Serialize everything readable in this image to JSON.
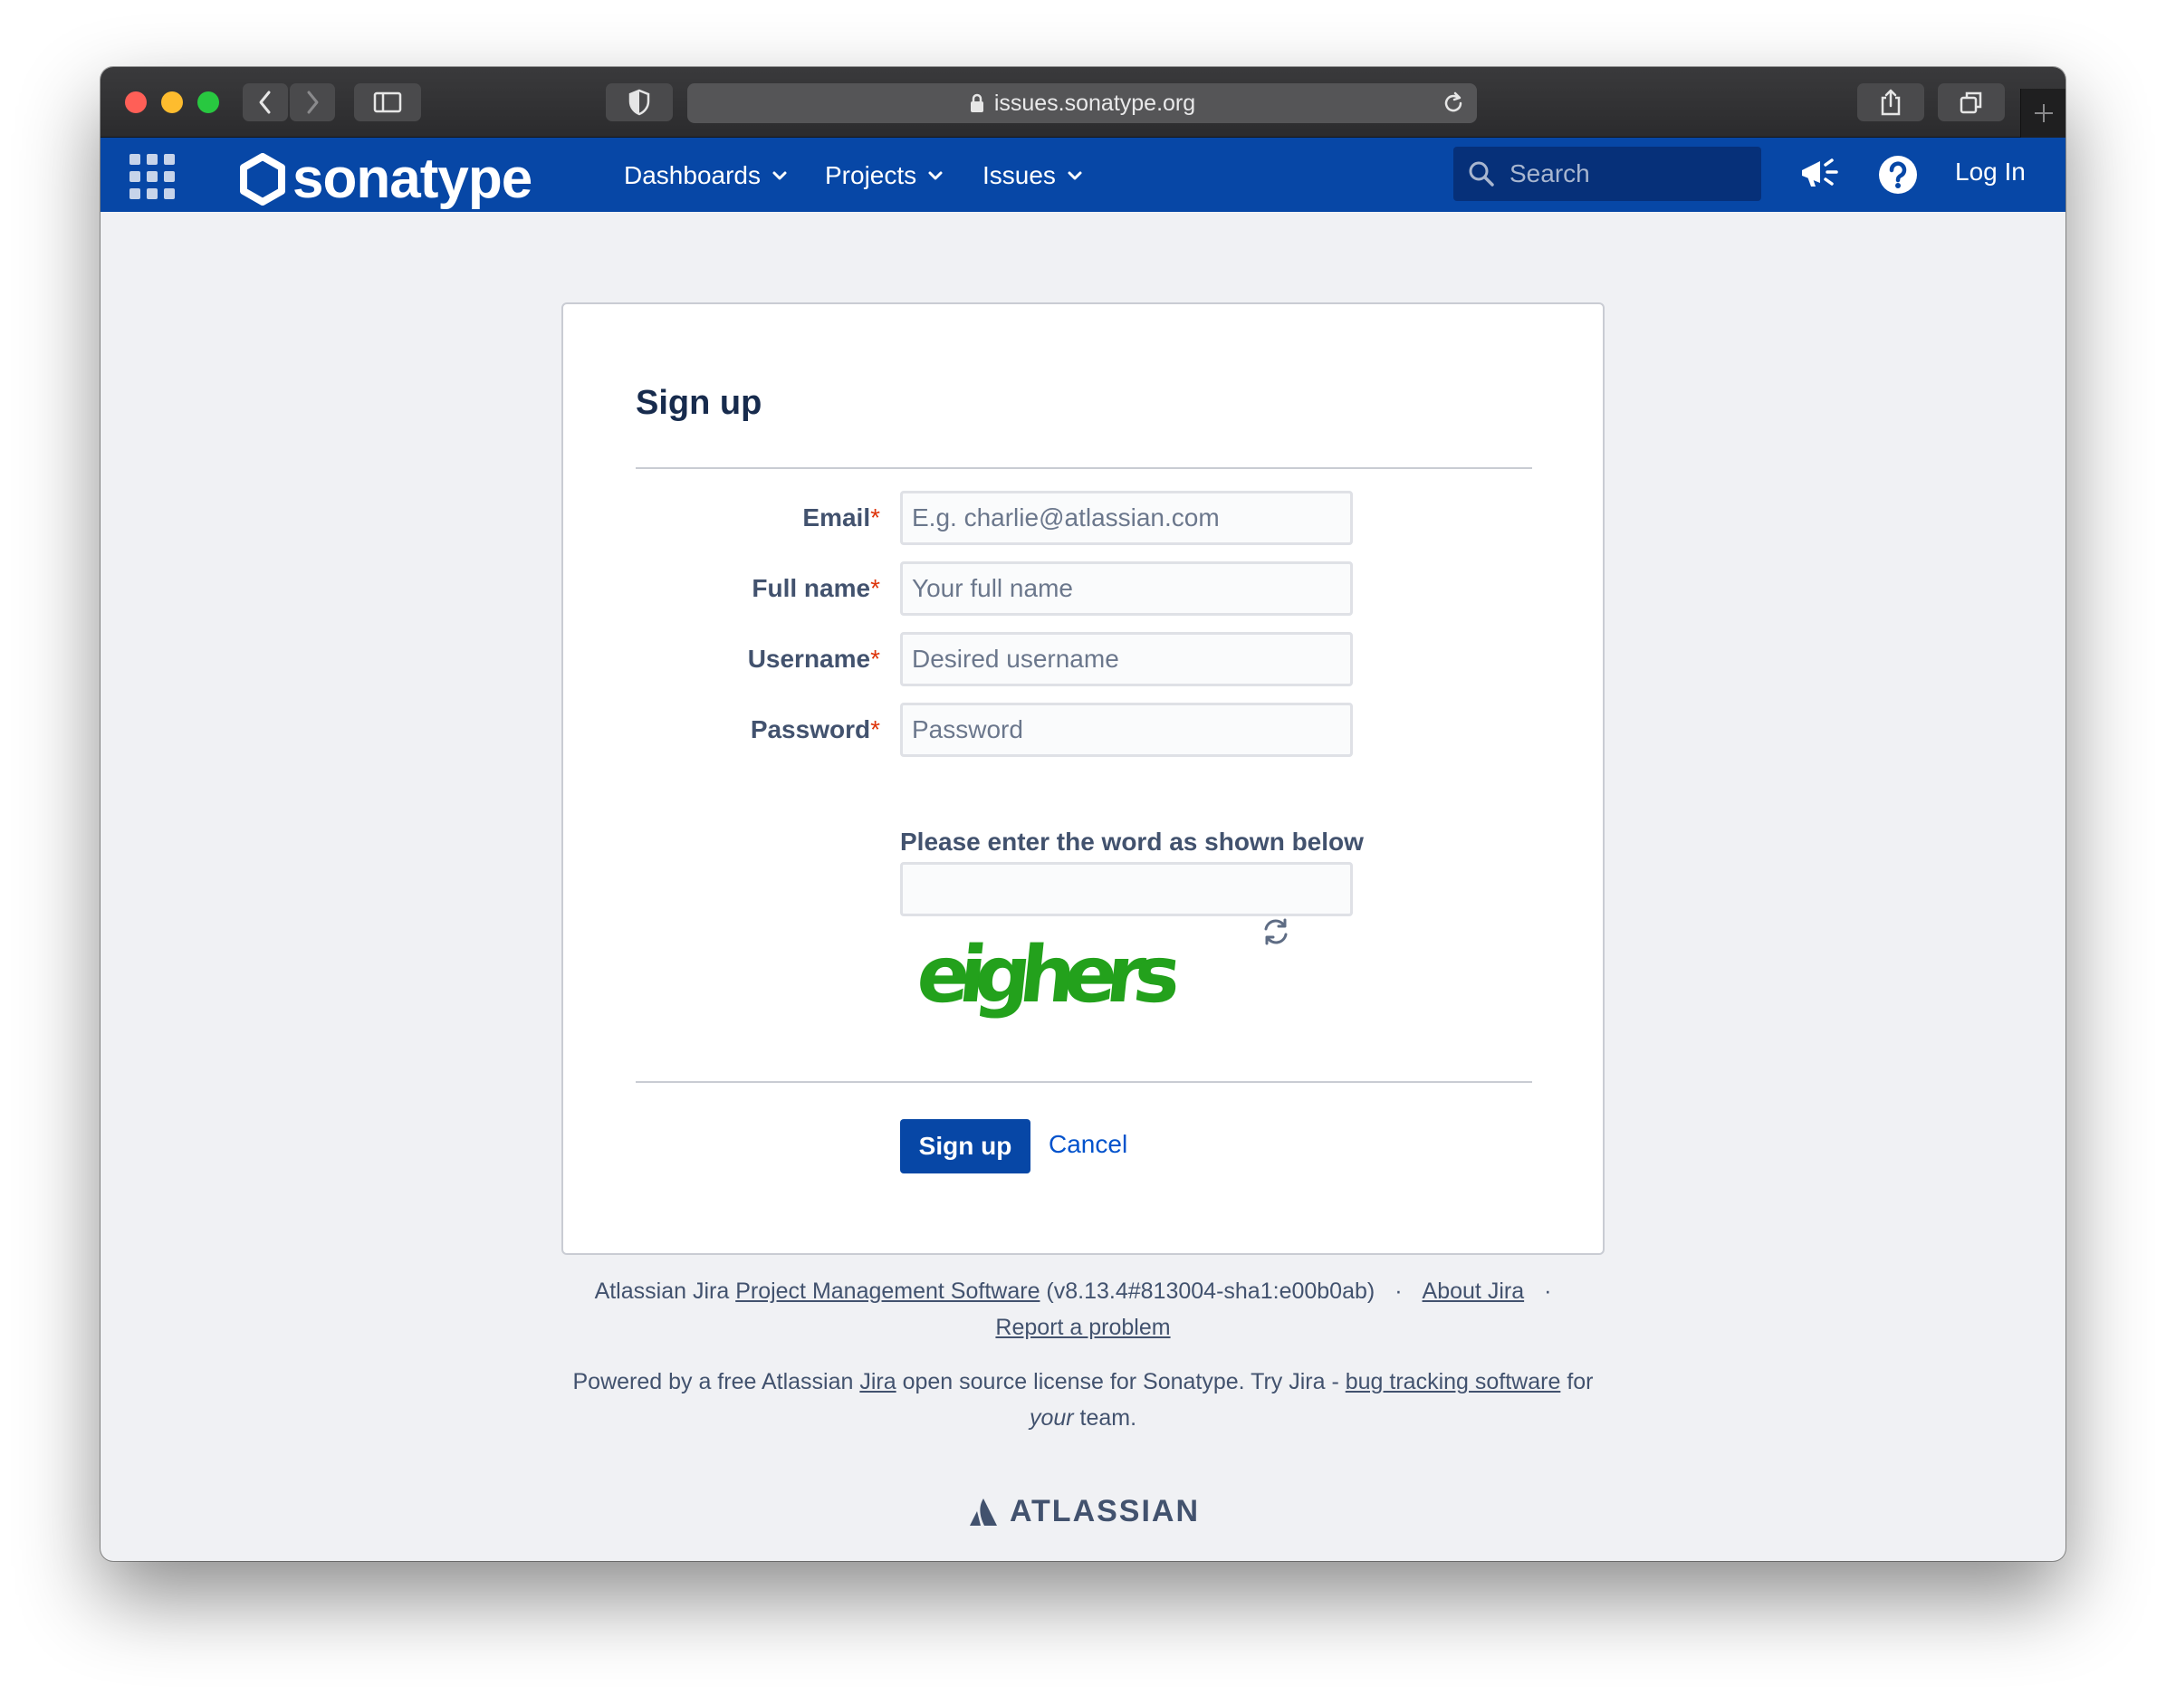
{
  "browser": {
    "url": "issues.sonatype.org"
  },
  "navbar": {
    "brand": "sonatype",
    "menus": [
      "Dashboards",
      "Projects",
      "Issues"
    ],
    "search_placeholder": "Search",
    "login": "Log In",
    "color": "#0747a6"
  },
  "form": {
    "title": "Sign up",
    "fields": [
      {
        "label": "Email",
        "placeholder": "E.g. charlie@atlassian.com",
        "required": "*"
      },
      {
        "label": "Full name",
        "placeholder": "Your full name",
        "required": "*"
      },
      {
        "label": "Username",
        "placeholder": "Desired username",
        "required": "*"
      },
      {
        "label": "Password",
        "placeholder": "Password",
        "required": "*"
      }
    ],
    "captcha_label": "Please enter the word as shown below",
    "captcha_word": "eighers",
    "submit": "Sign up",
    "cancel": "Cancel"
  },
  "footer": {
    "line1_prefix": "Atlassian Jira",
    "line1_link": "Project Management Software",
    "line1_version": "(v8.13.4#813004-sha1:e00b0ab)",
    "about": "About Jira",
    "report": "Report a problem",
    "line2_prefix": "Powered by a free Atlassian",
    "line2_jira": "Jira",
    "line2_mid": "open source license for Sonatype. Try Jira -",
    "line2_link": "bug tracking software",
    "line2_for": "for",
    "line2_your": "your",
    "line2_team": "team.",
    "brand": "ATLASSIAN"
  }
}
